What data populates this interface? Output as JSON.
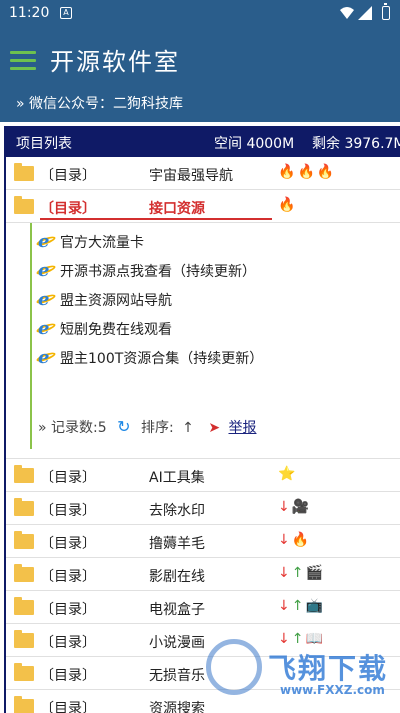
{
  "status": {
    "time": "11:20",
    "notif_glyph": "A"
  },
  "header": {
    "title": "开源软件室",
    "subtitle": "» 微信公众号：二狗科技库"
  },
  "panel": {
    "title": "项目列表",
    "space": "空间 4000M",
    "remain": "剩余 3976.7M"
  },
  "rows_top": [
    {
      "tag": "〔目录〕",
      "name": "宇宙最强导航",
      "icons": [
        "🔥",
        "🔥",
        "🔥"
      ]
    }
  ],
  "expanded": {
    "tag": "〔目录〕",
    "name": "接口资源",
    "icons": [
      "🔥"
    ],
    "items": [
      "官方大流量卡",
      "开源书源点我查看（持续更新）",
      "盟主资源网站导航",
      "短剧免费在线观看",
      "盟主100T资源合集（持续更新）"
    ],
    "record_label": "» 记录数:5",
    "sort_label": "排序:",
    "sort_arrow": "↑",
    "report_label": "举报"
  },
  "rows_bottom": [
    {
      "tag": "〔目录〕",
      "name": "AI工具集",
      "icons": [
        "⭐"
      ]
    },
    {
      "tag": "〔目录〕",
      "name": "去除水印",
      "icons": [
        "↓",
        "🎥"
      ]
    },
    {
      "tag": "〔目录〕",
      "name": "撸薅羊毛",
      "icons": [
        "↓",
        "🔥"
      ]
    },
    {
      "tag": "〔目录〕",
      "name": "影剧在线",
      "icons": [
        "↓",
        "↑",
        "🎬"
      ]
    },
    {
      "tag": "〔目录〕",
      "name": "电视盒子",
      "icons": [
        "↓",
        "↑",
        "📺"
      ]
    },
    {
      "tag": "〔目录〕",
      "name": "小说漫画",
      "icons": [
        "↓",
        "↑",
        "📖"
      ]
    },
    {
      "tag": "〔目录〕",
      "name": "无损音乐",
      "icons": []
    },
    {
      "tag": "〔目录〕",
      "name": "资源搜索",
      "icons": []
    }
  ],
  "watermark": {
    "text": "飞翔下载",
    "url": "www.FXXZ.com"
  }
}
